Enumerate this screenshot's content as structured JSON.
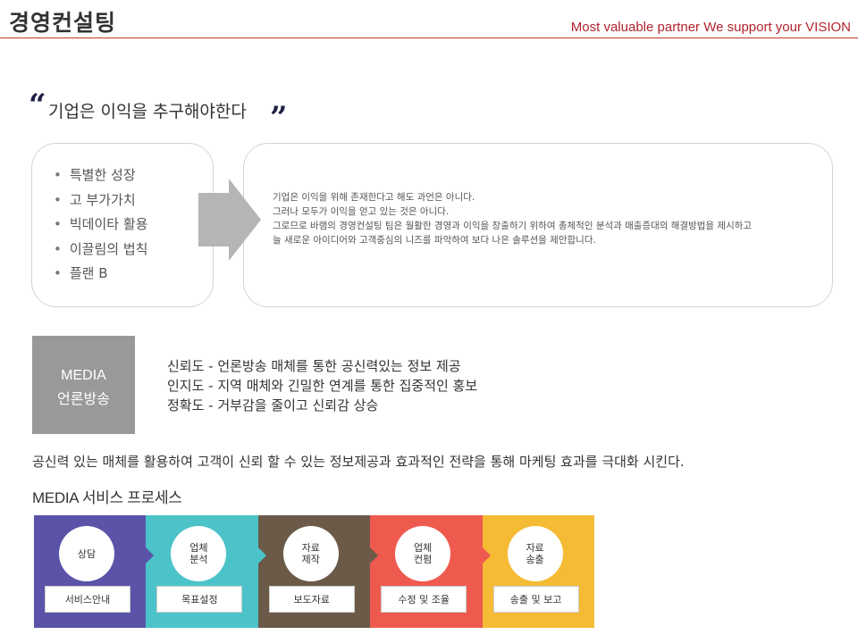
{
  "header": {
    "title": "경영컨설팅",
    "slogan": "Most valuable partner We support your VISION"
  },
  "quote": {
    "open_mark": "“",
    "text": "기업은 이익을 추구해야한다",
    "close_mark": "”"
  },
  "keywords": [
    "특별한 성장",
    "고 부가가치",
    "빅데이타 활용",
    "이끌림의 법칙",
    "플랜 B"
  ],
  "description": [
    "기업은 이익을 위해 존재한다고 해도 과언은 아니다.",
    "그러나 모두가 이익을 얻고 있는 것은 아니다.",
    "그로므로 바램의 경영컨설팅 팀은 월활한 경영과 이익을 창출하기 위하여 총체적인 분석과 매출증대의 해결방법을 제시하고",
    "늘 새로운 아이디어와 고객중심의 니즈를 파악하여 보다 나은 솔루션을 제안합니다."
  ],
  "media": {
    "line1": "MEDIA",
    "line2": "언론방송",
    "points": [
      "신뢰도 - 언론방송 매체를 통한 공신력있는 정보 제공",
      "인지도 - 지역 매체와 긴밀한 연계를 통한 집중적인 홍보",
      "정확도 - 거부감을 줄이고 신뢰감 상승"
    ]
  },
  "summary": "공신력 있는 매체를 활용하여 고객이 신뢰 할 수 있는 정보제공과 효과적인 전략을 통해 마케팅 효과를 극대화 시킨다.",
  "process": {
    "title": "MEDIA 서비스 프로세스",
    "steps": [
      {
        "circle_line1": "상담",
        "circle_line2": "",
        "label": "서비스안내",
        "color": "#5a53a8"
      },
      {
        "circle_line1": "업체",
        "circle_line2": "분석",
        "label": "목표설정",
        "color": "#4cc3c9"
      },
      {
        "circle_line1": "자료",
        "circle_line2": "제작",
        "label": "보도자료",
        "color": "#6b5a48"
      },
      {
        "circle_line1": "업체",
        "circle_line2": "컨펌",
        "label": "수정 및 조율",
        "color": "#ef5a4f"
      },
      {
        "circle_line1": "자료",
        "circle_line2": "송출",
        "label": "송출 및 보고",
        "color": "#f5bb34"
      }
    ]
  },
  "colors": {
    "accent_red": "#b3232c",
    "media_box_gray": "#999999",
    "arrow_gray": "#b5b5b5"
  }
}
